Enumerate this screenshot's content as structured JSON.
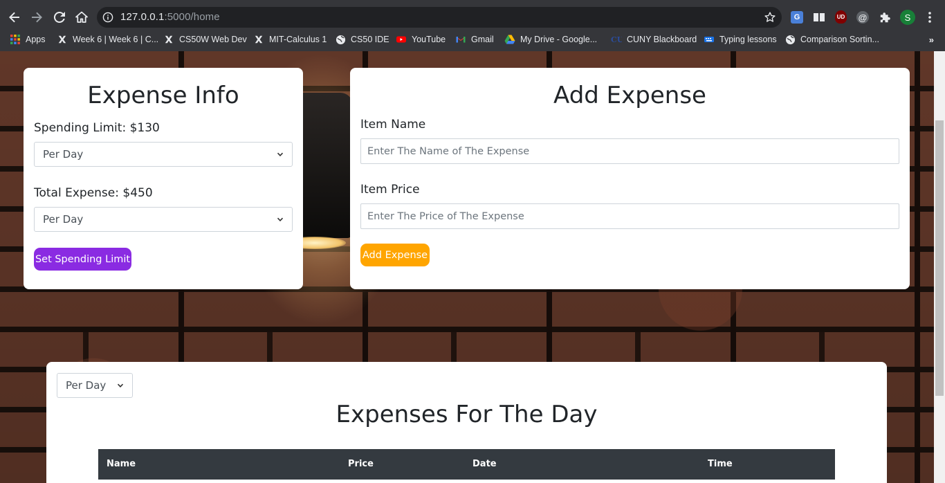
{
  "browser": {
    "url_host": "127.0.0.1",
    "url_path": ":5000/home",
    "avatar_letter": "S",
    "translate_label": "G",
    "ublock_label": "UD",
    "at_label": "@"
  },
  "bookmarks": [
    {
      "label": "Apps"
    },
    {
      "label": "Week 6 | Week 6 | C..."
    },
    {
      "label": "CS50W Web Dev"
    },
    {
      "label": "MIT-Calculus 1"
    },
    {
      "label": "CS50 IDE"
    },
    {
      "label": "YouTube"
    },
    {
      "label": "Gmail"
    },
    {
      "label": "My Drive - Google..."
    },
    {
      "label": "CUNY Blackboard"
    },
    {
      "label": "Typing lessons"
    },
    {
      "label": "Comparison Sortin..."
    }
  ],
  "bookmarks_more": "»",
  "info_card": {
    "title": "Expense Info",
    "spending_limit_label": "Spending Limit: $130",
    "spending_period": "Per Day",
    "total_expense_label": "Total Expense: $450",
    "total_period": "Per Day",
    "set_limit_button": "Set Spending Limit"
  },
  "add_card": {
    "title": "Add Expense",
    "item_name_label": "Item Name",
    "item_name_placeholder": "Enter The Name of The Expense",
    "item_price_label": "Item Price",
    "item_price_placeholder": "Enter The Price of The Expense",
    "add_button": "Add Expense"
  },
  "list_card": {
    "period": "Per Day",
    "title": "Expenses For The Day",
    "columns": [
      "Name",
      "Price",
      "Date",
      "Time"
    ]
  },
  "colors": {
    "purple_button": "#8a2be2",
    "orange_button": "#ffa500",
    "table_header": "#343a40"
  }
}
